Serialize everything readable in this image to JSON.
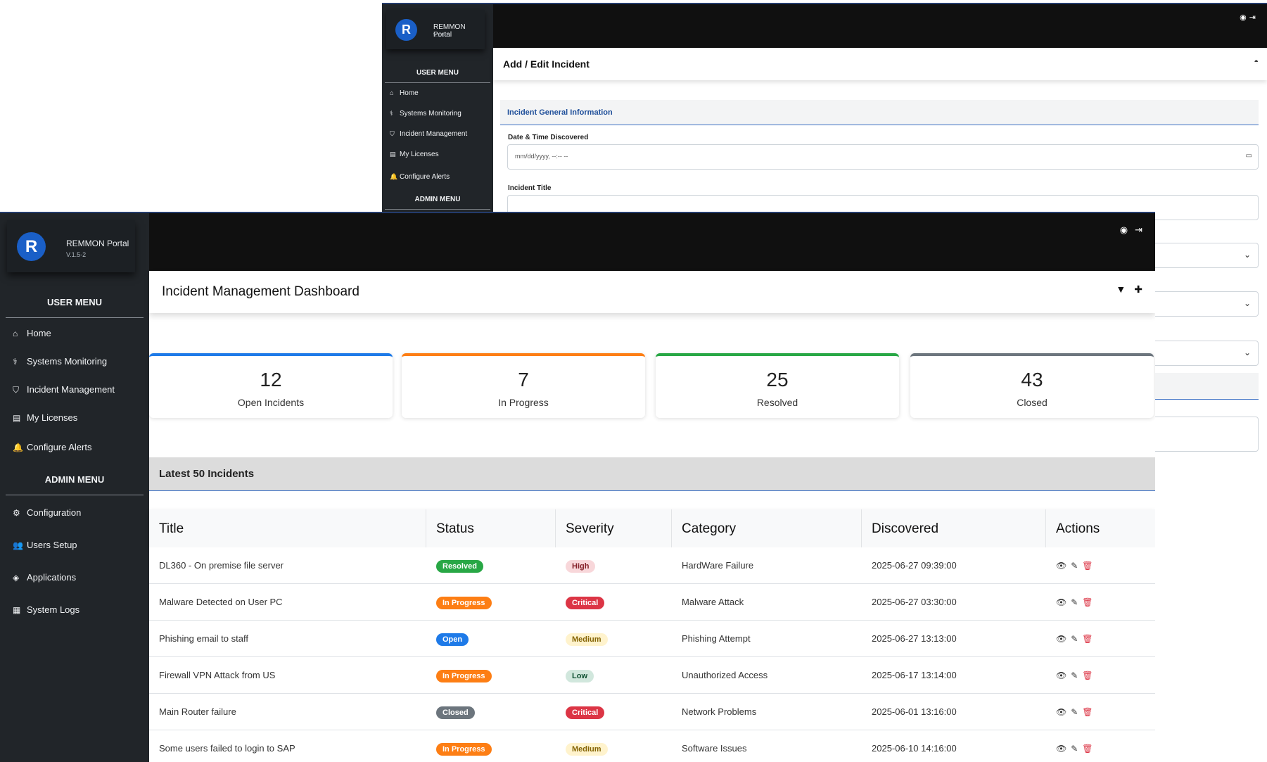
{
  "brand": {
    "name": "REMMON Portal",
    "version": "V.1.5-2",
    "logo_letter": "R"
  },
  "bg_window": {
    "user_menu_title": "USER MENU",
    "admin_menu_title": "ADMIN MENU",
    "user_menu": [
      {
        "label": "Home",
        "icon": "home-icon",
        "glyph": "⌂"
      },
      {
        "label": "Systems Monitoring",
        "icon": "stethoscope-icon",
        "glyph": "⚕"
      },
      {
        "label": "Incident Management",
        "icon": "shield-icon",
        "glyph": "⛉"
      },
      {
        "label": "My Licenses",
        "icon": "id-card-icon",
        "glyph": "▤"
      },
      {
        "label": "Configure Alerts",
        "icon": "bell-icon",
        "glyph": "🔔"
      }
    ],
    "page_title": "Add / Edit Incident",
    "section_title": "Incident General Information",
    "date_label": "Date & Time Discovered",
    "date_placeholder": "mm/dd/yyyy, --:-- --",
    "title_label": "Incident Title"
  },
  "sidebar": {
    "user_menu_title": "USER MENU",
    "admin_menu_title": "ADMIN MENU",
    "user_menu": [
      {
        "label": "Home",
        "icon": "home-icon",
        "glyph": "⌂"
      },
      {
        "label": "Systems Monitoring",
        "icon": "stethoscope-icon",
        "glyph": "⚕"
      },
      {
        "label": "Incident Management",
        "icon": "shield-icon",
        "glyph": "⛉"
      },
      {
        "label": "My Licenses",
        "icon": "id-card-icon",
        "glyph": "▤"
      },
      {
        "label": "Configure Alerts",
        "icon": "bell-icon",
        "glyph": "🔔"
      }
    ],
    "admin_menu": [
      {
        "label": "Configuration",
        "icon": "cogs-icon",
        "glyph": "⚙"
      },
      {
        "label": "Users Setup",
        "icon": "users-icon",
        "glyph": "👥"
      },
      {
        "label": "Applications",
        "icon": "diamond-icon",
        "glyph": "◈"
      },
      {
        "label": "System Logs",
        "icon": "file-icon",
        "glyph": "▦"
      }
    ]
  },
  "topbar": {
    "user_icon": "user-circle-icon",
    "logout_icon": "sign-out-icon"
  },
  "header": {
    "title": "Incident Management Dashboard",
    "filter_icon": "filter-icon",
    "add_icon": "plus-icon"
  },
  "stats": [
    {
      "value": "12",
      "label": "Open Incidents",
      "color": "#1e7ae8"
    },
    {
      "value": "7",
      "label": "In Progress",
      "color": "#fd7e14"
    },
    {
      "value": "25",
      "label": "Resolved",
      "color": "#28a745"
    },
    {
      "value": "43",
      "label": "Closed",
      "color": "#6c757d"
    }
  ],
  "latest_title": "Latest 50 Incidents",
  "table": {
    "columns": [
      "Title",
      "Status",
      "Severity",
      "Category",
      "Discovered",
      "Actions"
    ],
    "rows": [
      {
        "title": "DL360 - On premise file server",
        "status": "Resolved",
        "severity": "High",
        "category": "HardWare Failure",
        "discovered": "2025-06-27 09:39:00"
      },
      {
        "title": "Malware Detected on User PC",
        "status": "In Progress",
        "severity": "Critical",
        "category": "Malware Attack",
        "discovered": "2025-06-27 03:30:00"
      },
      {
        "title": "Phishing email to staff",
        "status": "Open",
        "severity": "Medium",
        "category": "Phishing Attempt",
        "discovered": "2025-06-27 13:13:00"
      },
      {
        "title": "Firewall VPN Attack from US",
        "status": "In Progress",
        "severity": "Low",
        "category": "Unauthorized Access",
        "discovered": "2025-06-17 13:14:00"
      },
      {
        "title": "Main Router failure",
        "status": "Closed",
        "severity": "Critical",
        "category": "Network Problems",
        "discovered": "2025-06-01 13:16:00"
      },
      {
        "title": "Some users failed to login to SAP",
        "status": "In Progress",
        "severity": "Medium",
        "category": "Software Issues",
        "discovered": "2025-06-10 14:16:00"
      }
    ]
  },
  "status_colors": {
    "Resolved": {
      "bg": "#28a745",
      "fg": "#ffffff"
    },
    "In Progress": {
      "bg": "#fd7e14",
      "fg": "#ffffff"
    },
    "Open": {
      "bg": "#1e7ae8",
      "fg": "#ffffff"
    },
    "Closed": {
      "bg": "#6c757d",
      "fg": "#ffffff"
    }
  },
  "severity_colors": {
    "High": {
      "bg": "#f8d7da",
      "fg": "#842029"
    },
    "Critical": {
      "bg": "#dc3545",
      "fg": "#ffffff"
    },
    "Medium": {
      "bg": "#fff3cd",
      "fg": "#856404"
    },
    "Low": {
      "bg": "#d1e7dd",
      "fg": "#0f5132"
    }
  }
}
